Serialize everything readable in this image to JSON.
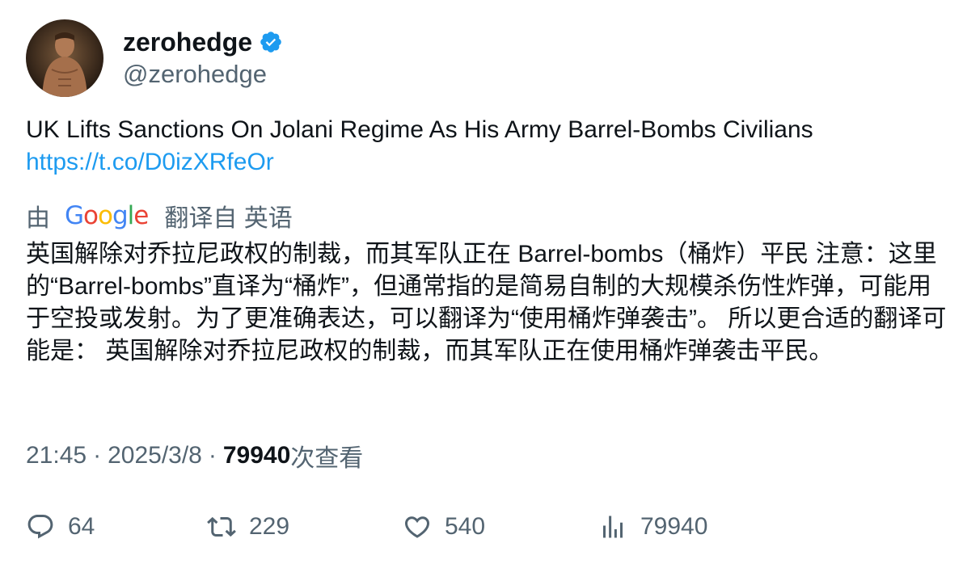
{
  "author": {
    "display_name": "zerohedge",
    "handle": "@zerohedge",
    "avatar_icon": "avatar-photo",
    "verified_icon": "verified-badge-icon"
  },
  "tweet": {
    "text": "UK Lifts Sanctions On Jolani Regime As His Army Barrel-Bombs Civilians",
    "link": "https://t.co/D0izXRfeOr"
  },
  "translation": {
    "prefix": "由",
    "provider": "Google",
    "suffix": "翻译自 英语",
    "text": "英国解除对乔拉尼政权的制裁，而其军队正在 Barrel-bombs（桶炸）平民 注意：这里的“Barrel-bombs”直译为“桶炸”，但通常指的是简易自制的大规模杀伤性炸弹，可能用于空投或发射。为了更准确表达，可以翻译为“使用桶炸弹袭击”。 所以更合适的翻译可能是： 英国解除对乔拉尼政权的制裁，而其军队正在使用桶炸弹袭击平民。"
  },
  "meta": {
    "time": "21:45",
    "separator": "·",
    "date": "2025/3/8",
    "views_count": "79940",
    "views_label": "次查看"
  },
  "actions": {
    "replies": "64",
    "retweets": "229",
    "likes": "540",
    "views": "79940"
  },
  "colors": {
    "link": "#1d9bf0",
    "secondary_text": "#536471",
    "primary_text": "#0f1419",
    "verified": "#1d9bf0"
  }
}
